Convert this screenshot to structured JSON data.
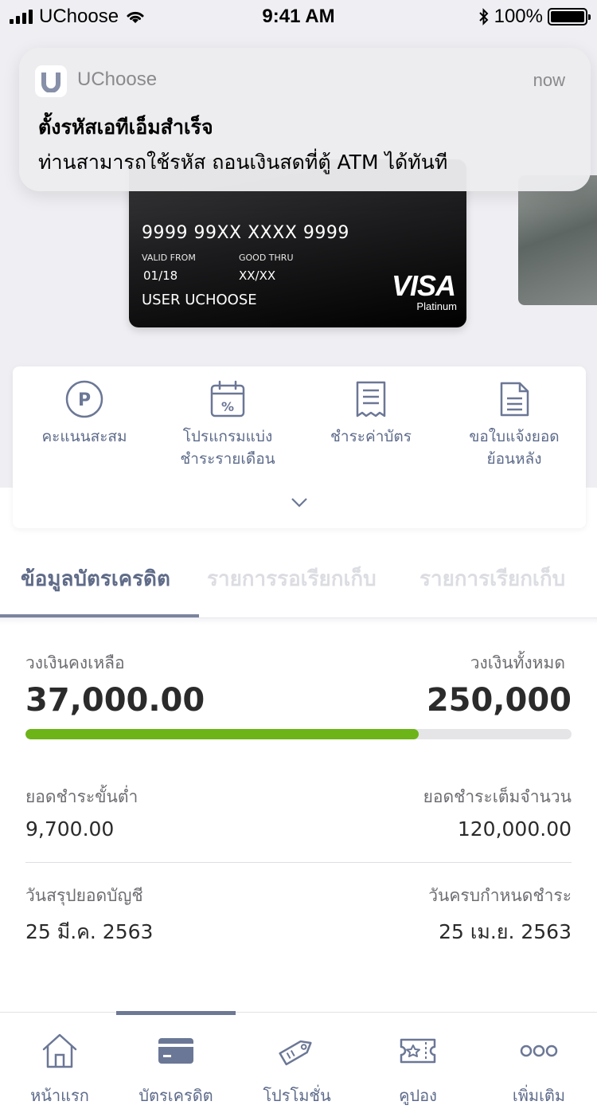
{
  "status_bar": {
    "carrier": "UChoose",
    "time": "9:41 AM",
    "battery": "100%"
  },
  "notification": {
    "app_name": "UChoose",
    "time": "now",
    "title": "ตั้งรหัสเอทีเอ็มสำเร็จ",
    "body": "ท่านสามารถใช้รหัส ถอนเงินสดที่ตู้ ATM ได้ทันที"
  },
  "card": {
    "number": "9999 99XX XXXX 9999",
    "valid_from_label": "VALID FROM",
    "valid_from": "01/18",
    "good_thru_label": "GOOD THRU",
    "good_thru": "XX/XX",
    "holder": "USER UCHOOSE",
    "brand": "VISA",
    "tier": "Platinum"
  },
  "actions": [
    {
      "label": "คะแนนสะสม",
      "icon": "points-icon"
    },
    {
      "label": "โปรแกรมแบ่ง\nชำระรายเดือน",
      "icon": "installment-calendar-icon"
    },
    {
      "label": "ชำระค่าบัตร",
      "icon": "receipt-icon"
    },
    {
      "label": "ขอใบแจ้งยอด\nย้อนหลัง",
      "icon": "statement-document-icon"
    }
  ],
  "tabs": [
    {
      "label": "ข้อมูลบัตรเครดิต",
      "active": true
    },
    {
      "label": "รายการรอเรียกเก็บ",
      "active": false
    },
    {
      "label": "รายการเรียกเก็บ",
      "active": false
    }
  ],
  "credit": {
    "available_label": "วงเงินคงเหลือ",
    "available_value": "37,000.00",
    "total_label": "วงเงินทั้งหมด",
    "total_value": "250,000",
    "usage_fraction": 0.72,
    "min_payment_label": "ยอดชำระขั้นต่ำ",
    "min_payment_value": "9,700.00",
    "full_payment_label": "ยอดชำระเต็มจำนวน",
    "full_payment_value": "120,000.00",
    "statement_date_label": "วันสรุปยอดบัญชี",
    "statement_date_value": "25 มี.ค. 2563",
    "due_date_label": "วันครบกำหนดชำระ",
    "due_date_value": "25 เม.ย. 2563"
  },
  "bottom_nav": [
    {
      "label": "หน้าแรก",
      "icon": "home-icon",
      "active": false
    },
    {
      "label": "บัตรเครดิต",
      "icon": "credit-card-icon",
      "active": true
    },
    {
      "label": "โปรโมชั่น",
      "icon": "promotion-tag-icon",
      "active": false
    },
    {
      "label": "คูปอง",
      "icon": "coupon-icon",
      "active": false
    },
    {
      "label": "เพิ่มเติม",
      "icon": "more-icon",
      "active": false
    }
  ],
  "colors": {
    "accent": "#5d6b8a",
    "progress": "#6cb417",
    "background_top": "#efeff3"
  }
}
